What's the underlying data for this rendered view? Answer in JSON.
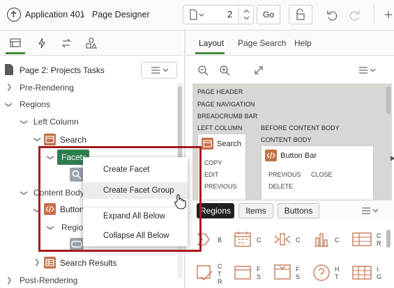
{
  "colors": {
    "accent_green": "#3f8c3f",
    "icon_orange": "#c4704a",
    "highlight_red": "#a31c1c",
    "facets_bg": "#2e7d4f"
  },
  "header": {
    "app_title": "Application 401",
    "separator": "\\",
    "page_title": "Page Designer",
    "page_number": "2",
    "go_label": "Go",
    "icons": [
      "app-up-icon",
      "page-icon",
      "lock-icon",
      "undo-icon",
      "redo-icon",
      "plus-icon"
    ]
  },
  "left_panel": {
    "tabs": [
      "rendering-tab-icon",
      "dynamic-actions-tab-icon",
      "processing-tab-icon",
      "shared-components-tab-icon"
    ],
    "tree_title": "Page 2: Projects Tasks",
    "tree": {
      "pre_rendering": "Pre-Rendering",
      "regions": "Regions",
      "left_column": "Left Column",
      "search": "Search",
      "facets": "Facets",
      "content_body": "Content Body",
      "button": "Button",
      "region_partial": "Regior",
      "search_results": "Search Results",
      "post_rendering": "Post-Rendering"
    }
  },
  "context_menu": {
    "items": [
      "Create Facet",
      "Create Facet Group",
      "Expand All Below",
      "Collapse All Below"
    ],
    "hovered": "Create Facet Group"
  },
  "right_panel": {
    "tabs": [
      "Layout",
      "Page Search",
      "Help"
    ],
    "active_tab": "Layout",
    "layout": {
      "page_header": "PAGE HEADER",
      "page_navigation": "PAGE NAVIGATION",
      "breadcrumb_bar": "BREADCRUMB BAR",
      "left_column": "LEFT COLUMN",
      "before_content_body": "BEFORE CONTENT BODY",
      "content_body": "CONTENT BODY",
      "search_card": {
        "title": "Search",
        "links": [
          "COPY",
          "EDIT",
          "PREVIOUS"
        ]
      },
      "button_bar_card": {
        "title": "Button Bar",
        "links": [
          "PREVIOUS",
          "CLOSE",
          "DELETE"
        ]
      }
    },
    "gallery_tabs": [
      "Regions",
      "Items",
      "Buttons"
    ],
    "gallery_active": "Regions",
    "gallery_letters": [
      "B",
      "C",
      "C",
      "C",
      "C R",
      "C T R",
      "F S",
      "F S",
      "H T",
      "I. G"
    ]
  }
}
